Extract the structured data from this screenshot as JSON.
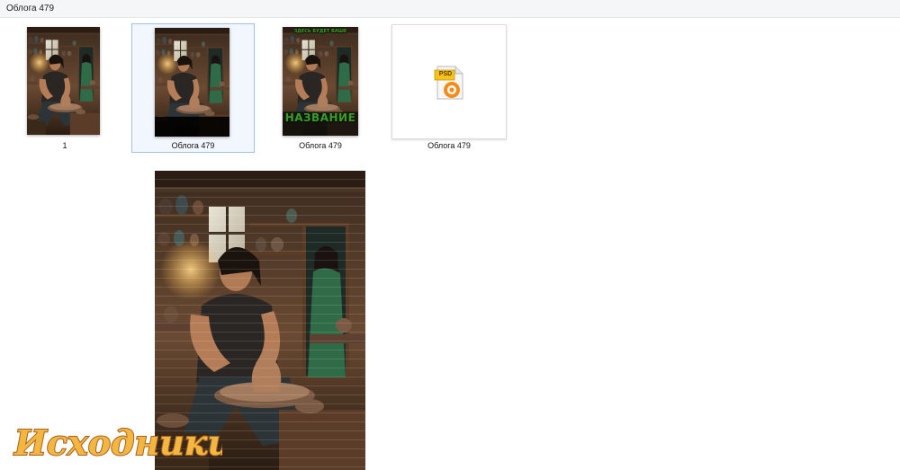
{
  "window": {
    "title": "Облога 479"
  },
  "files": [
    {
      "caption": "1"
    },
    {
      "caption": "Облога  479"
    },
    {
      "caption": "Облога 479",
      "cover_top_text": "ЗДЕСЬ БУДЕТ ВАШЕ",
      "cover_title": "НАЗВАНИЕ"
    },
    {
      "caption": "Облога 479",
      "badge": "PSD",
      "icon": "psd-file-icon"
    }
  ],
  "watermark": {
    "text": "Исходники"
  },
  "colors": {
    "selection": "#9fc0ea",
    "cover_title": "#3a9a2c",
    "psd_badge": "#f6c21c",
    "psd_ring": "#f28c1a"
  }
}
